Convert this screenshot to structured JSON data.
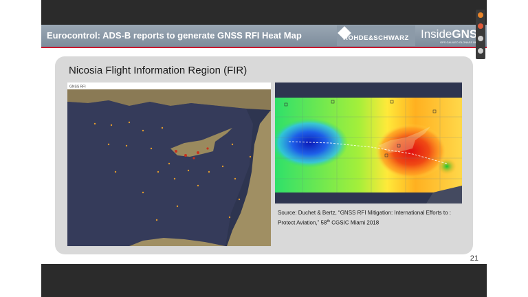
{
  "slide": {
    "title": "Eurocontrol: ADS-B reports to generate GNSS RFI Heat Map",
    "subtitle": "Nicosia Flight Information Region (FIR)",
    "logos": {
      "rohde_schwarz": "ROHDE&SCHWARZ",
      "insidegnss_prefix": "Inside",
      "insidegnss_suffix": "GNSS",
      "insidegnss_tagline": "GPS GALILEO GLONASS BEIDOU"
    },
    "left_map": {
      "header_label": "GNSS RFI"
    },
    "source": {
      "prefix": "Source: Duchet & Bertz, “GNSS RFI Mitigation: International Efforts to : Protect Aviation,” 58",
      "superscript": "th",
      "suffix": " CGSIC Miami 2018"
    },
    "page_number": "21"
  },
  "colors": {
    "title_bar": "#8897a6",
    "accent_red": "#c8102e",
    "panel": "#d9d9d9",
    "map_sea": "#2e3550",
    "land": "#8a7a55",
    "heat_low": "#1e3fd8",
    "heat_high": "#e31a1a"
  },
  "sidebar_icons": [
    "share-icon",
    "microphone-icon",
    "email-icon",
    "link-icon"
  ]
}
